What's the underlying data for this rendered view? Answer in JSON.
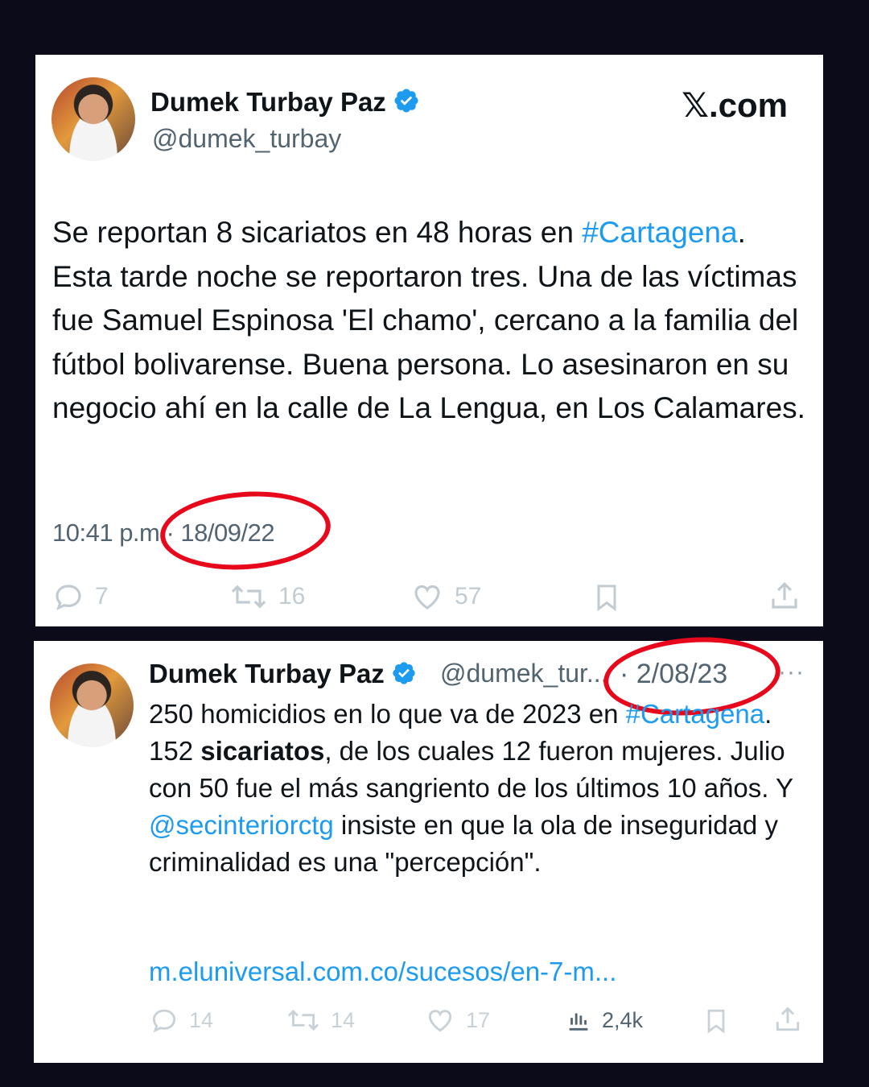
{
  "colors": {
    "link": "#1d9bf0",
    "verified": "#1d9bf0",
    "highlight_oval": "#e8081c",
    "background": "#0b0b1a"
  },
  "brand": {
    "logo_text": "𝕏.com"
  },
  "tweet1": {
    "author_name": "Dumek Turbay Paz",
    "author_handle": "@dumek_turbay",
    "text_parts": {
      "p1": "Se reportan 8 sicariatos en 48 horas en ",
      "hashtag": "#Cartagena",
      "p2": ". Esta tarde noche se reportaron tres. Una de las víctimas fue Samuel Espinosa 'El chamo', cercano a la familia del fútbol bolivarense. Buena persona. Lo asesinaron en su negocio ahí en la calle de La Lengua, en Los Calamares."
    },
    "time": "10:41 p.m",
    "date": "· 18/09/22",
    "replies": "7",
    "retweets": "16",
    "likes": "57"
  },
  "tweet2": {
    "author_name": "Dumek Turbay Paz",
    "author_handle": "@dumek_tur...",
    "date": "· 2/08/23",
    "more": "···",
    "text_parts": {
      "p1": "250 homicidios en lo que va de 2023 en ",
      "hashtag": "#Cartagena",
      "p2": ". 152 ",
      "bold": "sicariatos",
      "p3": ", de los cuales 12 fueron mujeres. Julio con 50 fue el más sangriento de los últimos 10 años. Y ",
      "mention": "@secinteriorctg",
      "p4": " insiste en que la ola de inseguridad y criminalidad es una \"percepción\"."
    },
    "link": "m.eluniversal.com.co/sucesos/en-7-m...",
    "replies": "14",
    "retweets": "14",
    "likes": "17",
    "views": "2,4k"
  }
}
